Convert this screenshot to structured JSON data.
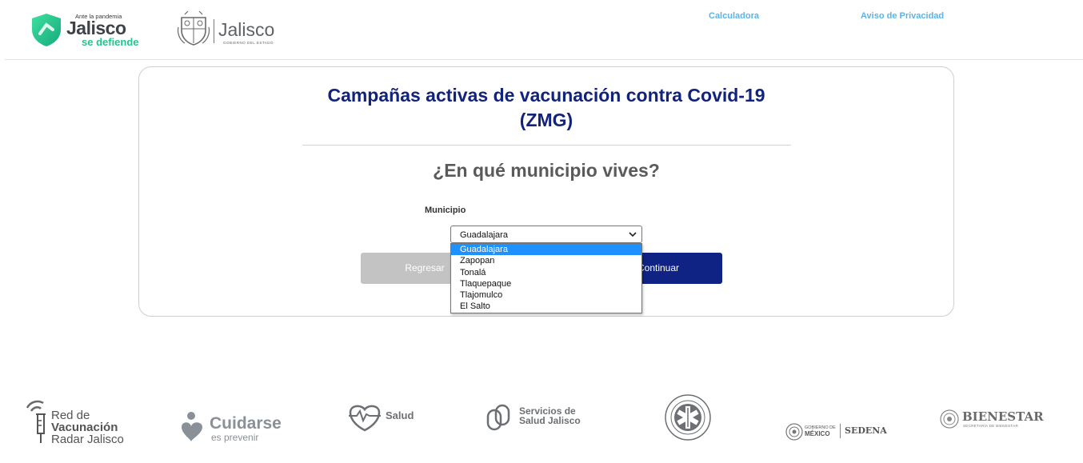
{
  "header": {
    "brand": {
      "tagline": "Ante la pandemia",
      "name": "Jalisco",
      "subtitle": "se defiende"
    },
    "government": {
      "name": "Jalisco",
      "subtitle": "GOBIERNO DEL ESTADO"
    },
    "nav": {
      "calculator": "Calculadora",
      "privacy": "Aviso de Privacidad"
    }
  },
  "card": {
    "title_line1": "Campañas activas de vacunación contra Covid-19",
    "title_line2": "(ZMG)",
    "question": "¿En qué municipio vives?",
    "field_label": "Municipio",
    "select": {
      "selected": "Guadalajara",
      "options": [
        "Guadalajara",
        "Zapopan",
        "Tonalá",
        "Tlaquepaque",
        "Tlajomulco",
        "El Salto"
      ]
    },
    "back_label": "Regresar",
    "continue_label": "Continuar"
  },
  "footer": {
    "red": {
      "line1": "Red de",
      "line2": "Vacunación",
      "line3": "Radar Jalisco"
    },
    "cuidarse": {
      "main": "Cuidarse",
      "sub": "es prevenir"
    },
    "salud": "Salud",
    "ssj": {
      "line1": "Servicios de",
      "line2": "Salud Jalisco"
    },
    "sedena": {
      "gob_line1": "GOBIERNO DE",
      "gob_line2": "MÉXICO",
      "name": "SEDENA"
    },
    "bienestar": {
      "name": "BIENESTAR",
      "sub": "SECRETARÍA DE BIENESTAR"
    }
  },
  "colors": {
    "title_blue": "#12237b",
    "continue_button": "#0f2384",
    "back_button": "#c3c3c3",
    "nav_link": "#5bb3e8",
    "brand_green": "#23c48c",
    "selected_option": "#1e90ff"
  },
  "icons": {
    "brand_shield": "shield-check-icon",
    "crest": "state-crest-icon",
    "select_arrow": "chevron-down-icon"
  }
}
